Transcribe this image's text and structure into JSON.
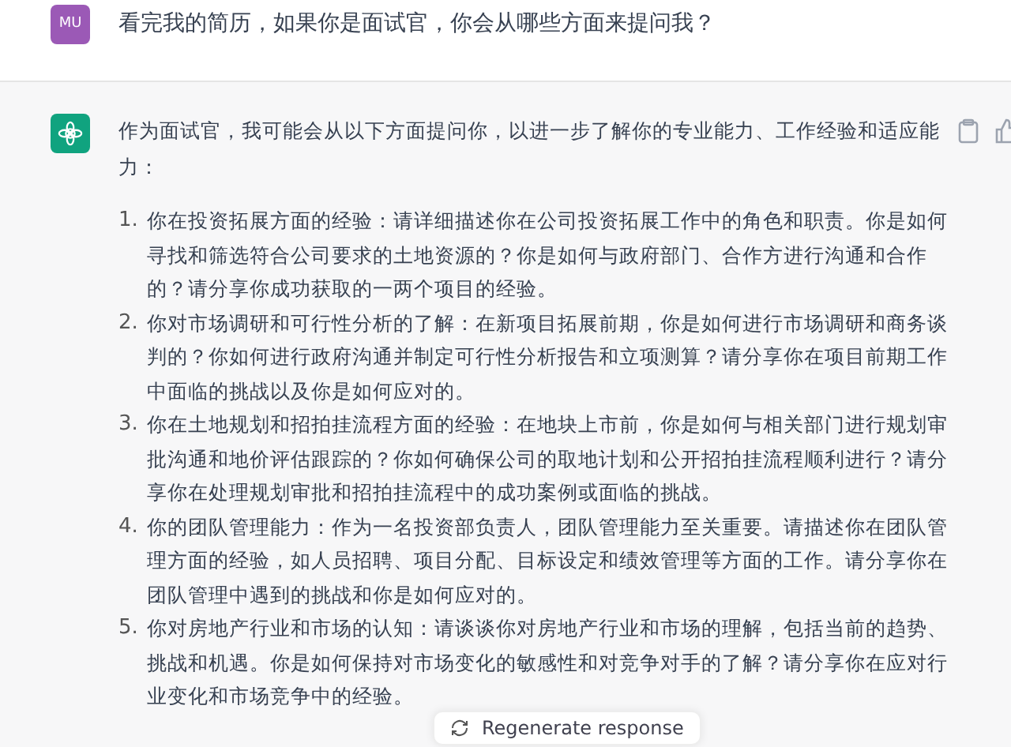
{
  "user_message": {
    "avatar": "MU",
    "text": "看完我的简历，如果你是面试官，你会从哪些方面来提问我？"
  },
  "assistant_message": {
    "intro": "作为面试官，我可能会从以下方面提问你，以进一步了解你的专业能力、工作经验和适应能力：",
    "items": [
      {
        "number": "1.",
        "text": "你在投资拓展方面的经验：请详细描述你在公司投资拓展工作中的角色和职责。你是如何寻找和筛选符合公司要求的土地资源的？你是如何与政府部门、合作方进行沟通和合作的？请分享你成功获取的一两个项目的经验。"
      },
      {
        "number": "2.",
        "text": "你对市场调研和可行性分析的了解：在新项目拓展前期，你是如何进行市场调研和商务谈判的？你如何进行政府沟通并制定可行性分析报告和立项测算？请分享你在项目前期工作中面临的挑战以及你是如何应对的。"
      },
      {
        "number": "3.",
        "text": "你在土地规划和招拍挂流程方面的经验：在地块上市前，你是如何与相关部门进行规划审批沟通和地价评估跟踪的？你如何确保公司的取地计划和公开招拍挂流程顺利进行？请分享你在处理规划审批和招拍挂流程中的成功案例或面临的挑战。"
      },
      {
        "number": "4.",
        "text": "你的团队管理能力：作为一名投资部负责人，团队管理能力至关重要。请描述你在团队管理方面的经验，如人员招聘、项目分配、目标设定和绩效管理等方面的工作。请分享你在团队管理中遇到的挑战和你是如何应对的。"
      },
      {
        "number": "5.",
        "text": "你对房地产行业和市场的认知：请谈谈你对房地产行业和市场的理解，包括当前的趋势、挑战和机遇。你是如何保持对市场变化的敏感性和对竞争对手的了解？请分享你在应对行业变化和市场竞争中的经验。"
      }
    ]
  },
  "regenerate_button": {
    "label": "Regenerate response"
  }
}
